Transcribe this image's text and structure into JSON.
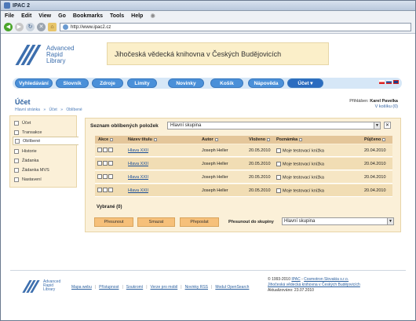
{
  "window": {
    "title": "IPAC 2"
  },
  "menu": [
    "File",
    "Edit",
    "View",
    "Go",
    "Bookmarks",
    "Tools",
    "Help"
  ],
  "address": {
    "url": "http://www.ipac2.cz"
  },
  "site": {
    "logo_lines": [
      "Advanced",
      "Rapid",
      "Library"
    ],
    "banner": "Jihočeská vědecká knihovna v Českých Budějovicích"
  },
  "nav_tabs": [
    "Vyhledávání",
    "Slovník",
    "Zdroje",
    "Limity",
    "Novinky",
    "Košík",
    "Nápověda",
    "Účet ▾"
  ],
  "page": {
    "title": "Účet",
    "breadcrumb": [
      "Hlavní stránka",
      "»",
      "Účet",
      "»",
      "Oblíbené"
    ],
    "logged_label": "Přihlášen: ",
    "logged_name": "Karel Pavelka",
    "cart": "V košíku (0)"
  },
  "sidebar": [
    "Účet",
    "Transakce",
    "Oblíbené",
    "Historie",
    "Žádanka",
    "Žádanka MVS",
    "Nastavení"
  ],
  "favorites": {
    "list_label": "Seznam oblíbených položek",
    "group_selected": "Hlavní skupina",
    "columns": [
      "Akce",
      "Název titulu",
      "Autor",
      "Vloženo",
      "Poznámka",
      "Půjčeno"
    ],
    "rows": [
      {
        "title": "Hlava XXII",
        "author": "Joseph Heller",
        "added": "20.05.2010",
        "note": "Moje testovací knížka",
        "borrowed": "20.04.2010"
      },
      {
        "title": "Hlava XXII",
        "author": "Joseph Heller",
        "added": "20.05.2010",
        "note": "Moje testovací knížka",
        "borrowed": "20.04.2010"
      },
      {
        "title": "Hlava XXII",
        "author": "Joseph Heller",
        "added": "20.05.2010",
        "note": "Moje testovací knížka",
        "borrowed": "20.04.2010"
      },
      {
        "title": "Hlava XXII",
        "author": "Joseph Heller",
        "added": "20.05.2010",
        "note": "Moje testovací knížka",
        "borrowed": "20.04.2010"
      }
    ],
    "selected_count": "Vybrané (0)",
    "btn_move": "Přesunout",
    "btn_delete": "Smazat",
    "btn_forward": "Přeposlat",
    "move_label": "Přesunout do skupiny",
    "move_target": "Hlavní skupina"
  },
  "footer": {
    "links": [
      "Mapa webu",
      "Přístupnost",
      "Soukromí",
      "Verze pro mobil",
      "Novinky RSS",
      "Modul OpenSearch"
    ],
    "copyright_prefix": "© 1993-2010 ",
    "ipac_link": "IPAC",
    "company_link": "Cosmotron Slovakia s.r.o.",
    "library_link": "Jihočeská vědecká knihovna v Českých Budějovicích",
    "updated": "Aktualizováno: 23.07.2010"
  },
  "colors": {
    "accent": "#4a90d9",
    "panel": "#fbf0d8",
    "header_row": "#e4c69a",
    "button": "#f6c07a"
  }
}
